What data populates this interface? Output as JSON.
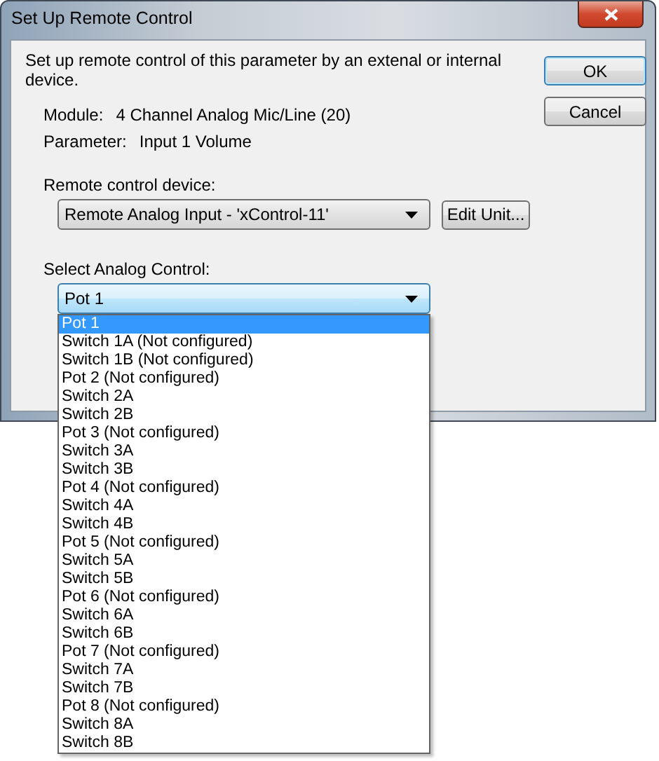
{
  "window": {
    "title": "Set Up Remote Control"
  },
  "description": "Set up remote control of this parameter by an extenal or internal device.",
  "info": [
    {
      "label": "Module:",
      "value": "4 Channel Analog Mic/Line (20)"
    },
    {
      "label": "Parameter:",
      "value": "Input 1 Volume"
    }
  ],
  "device": {
    "label": "Remote control device:",
    "value": "Remote Analog Input - 'xControl-11'",
    "button": "Edit Unit..."
  },
  "control": {
    "label": "Select Analog Control:",
    "value": "Pot 1",
    "expanded": true,
    "options": [
      {
        "label": "Pot 1",
        "selected": true
      },
      {
        "label": "Switch 1A (Not configured)",
        "selected": false
      },
      {
        "label": "Switch 1B (Not configured)",
        "selected": false
      },
      {
        "label": "Pot 2 (Not configured)",
        "selected": false
      },
      {
        "label": "Switch 2A",
        "selected": false
      },
      {
        "label": "Switch 2B",
        "selected": false
      },
      {
        "label": "Pot 3 (Not configured)",
        "selected": false
      },
      {
        "label": "Switch 3A",
        "selected": false
      },
      {
        "label": "Switch 3B",
        "selected": false
      },
      {
        "label": "Pot 4 (Not configured)",
        "selected": false
      },
      {
        "label": "Switch 4A",
        "selected": false
      },
      {
        "label": "Switch 4B",
        "selected": false
      },
      {
        "label": "Pot 5 (Not configured)",
        "selected": false
      },
      {
        "label": "Switch 5A",
        "selected": false
      },
      {
        "label": "Switch 5B",
        "selected": false
      },
      {
        "label": "Pot 6 (Not configured)",
        "selected": false
      },
      {
        "label": "Switch 6A",
        "selected": false
      },
      {
        "label": "Switch 6B",
        "selected": false
      },
      {
        "label": "Pot 7 (Not configured)",
        "selected": false
      },
      {
        "label": "Switch 7A",
        "selected": false
      },
      {
        "label": "Switch 7B",
        "selected": false
      },
      {
        "label": "Pot 8 (Not configured)",
        "selected": false
      },
      {
        "label": "Switch 8A",
        "selected": false
      },
      {
        "label": "Switch 8B",
        "selected": false
      }
    ]
  },
  "buttons": [
    {
      "label": "OK",
      "default": true
    },
    {
      "label": "Cancel",
      "default": false
    }
  ]
}
